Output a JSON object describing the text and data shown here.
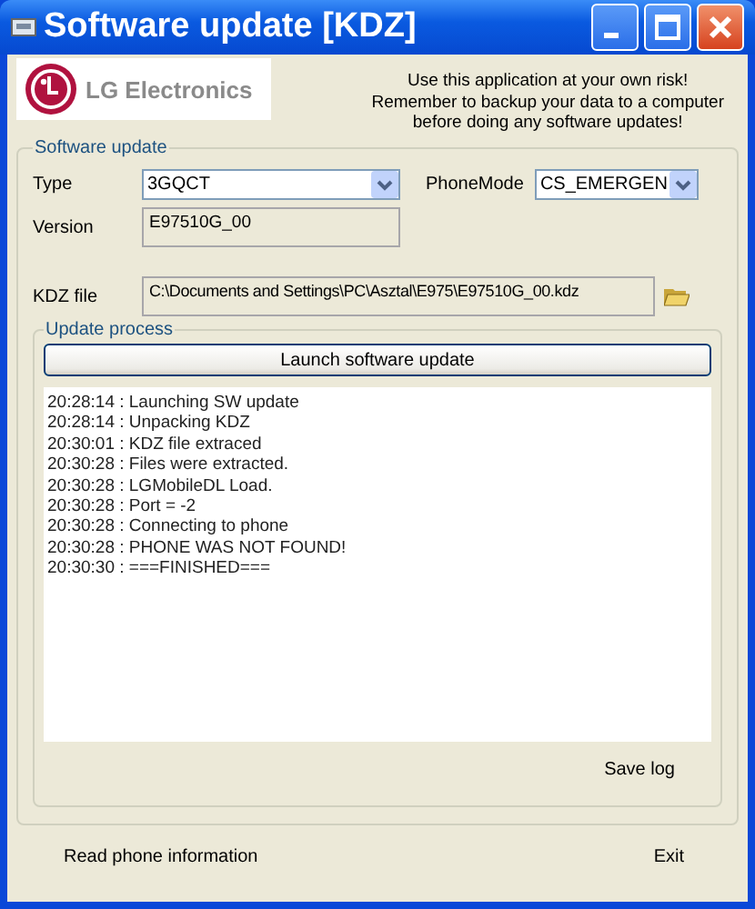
{
  "window": {
    "title": "Software update [KDZ]"
  },
  "logo": {
    "text": "LG Electronics"
  },
  "warning": "Use this application at your own risk!\nRemember to backup your data to a computer\nbefore doing any software updates!",
  "software_update": {
    "title": "Software update",
    "type": {
      "label": "Type",
      "value": "3GQCT"
    },
    "phone_mode": {
      "label": "PhoneMode",
      "value": "CS_EMERGEN"
    },
    "version": {
      "label": "Version",
      "value": "E97510G_00"
    },
    "kdz_file": {
      "label": "KDZ file",
      "value": "C:\\Documents and Settings\\PC\\Asztal\\E975\\E97510G_00.kdz"
    }
  },
  "update_process": {
    "title": "Update process",
    "launch_button": "Launch software update",
    "log": [
      "20:28:14 : Launching SW update",
      "20:28:14 : Unpacking KDZ",
      "20:30:01 : KDZ file extraced",
      "20:30:28 : Files were extracted.",
      "20:30:28 : LGMobileDL Load.",
      "20:30:28 : Port = -2",
      "20:30:28 : Connecting to phone",
      "20:30:28 : PHONE WAS NOT FOUND!",
      "20:30:30 : ===FINISHED==="
    ],
    "save_log": "Save log"
  },
  "buttons": [
    "Read phone information",
    "Exit"
  ]
}
